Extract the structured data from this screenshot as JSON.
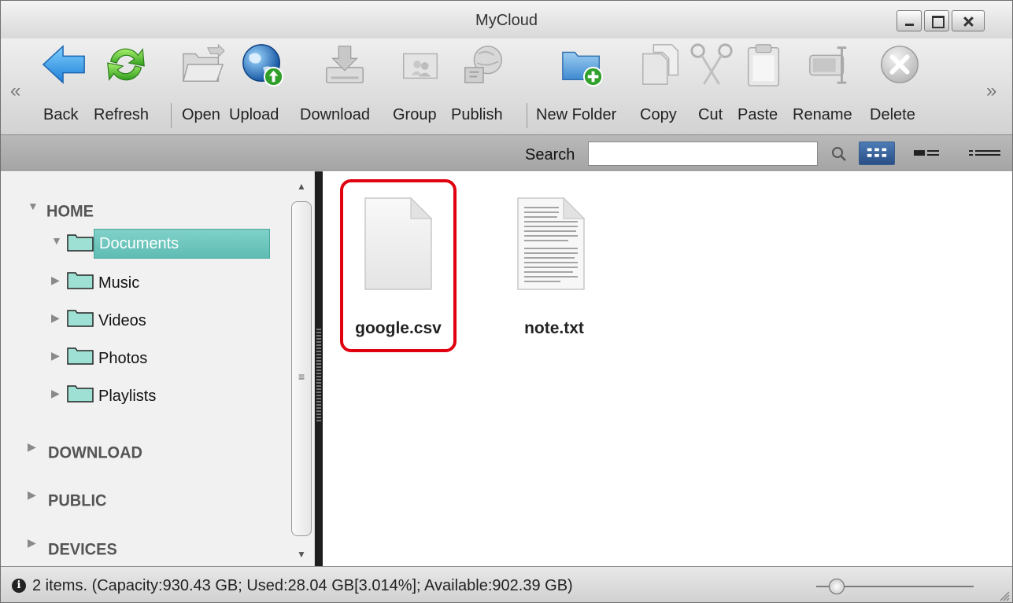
{
  "window": {
    "title": "MyCloud"
  },
  "toolbar": {
    "scroll_left": "«",
    "scroll_right": "»",
    "buttons": [
      {
        "id": "back",
        "label": "Back",
        "icon": "back-arrow-icon"
      },
      {
        "id": "refresh",
        "label": "Refresh",
        "icon": "refresh-icon"
      },
      {
        "id": "open",
        "label": "Open",
        "icon": "open-folder-icon"
      },
      {
        "id": "upload",
        "label": "Upload",
        "icon": "globe-upload-icon"
      },
      {
        "id": "download",
        "label": "Download",
        "icon": "download-icon"
      },
      {
        "id": "group",
        "label": "Group",
        "icon": "group-icon"
      },
      {
        "id": "publish",
        "label": "Publish",
        "icon": "publish-icon"
      },
      {
        "id": "new_folder",
        "label": "New Folder",
        "icon": "new-folder-icon"
      },
      {
        "id": "copy",
        "label": "Copy",
        "icon": "copy-icon"
      },
      {
        "id": "cut",
        "label": "Cut",
        "icon": "scissors-icon"
      },
      {
        "id": "paste",
        "label": "Paste",
        "icon": "clipboard-icon"
      },
      {
        "id": "rename",
        "label": "Rename",
        "icon": "rename-icon"
      },
      {
        "id": "delete",
        "label": "Delete",
        "icon": "delete-icon"
      }
    ]
  },
  "search": {
    "label": "Search",
    "value": "",
    "placeholder": ""
  },
  "sidebar": {
    "home": {
      "label": "HOME",
      "folders": [
        {
          "label": "Documents",
          "selected": true,
          "expanded": true
        },
        {
          "label": "Music"
        },
        {
          "label": "Videos"
        },
        {
          "label": "Photos"
        },
        {
          "label": "Playlists"
        }
      ]
    },
    "sections": [
      {
        "label": "DOWNLOAD"
      },
      {
        "label": "PUBLIC"
      },
      {
        "label": "DEVICES"
      }
    ]
  },
  "files": [
    {
      "name": "google.csv",
      "type": "blank-file-icon",
      "selected": true
    },
    {
      "name": "note.txt",
      "type": "text-file-icon",
      "selected": false
    }
  ],
  "status": {
    "text": "2 items. (Capacity:930.43 GB; Used:28.04 GB[3.014%]; Available:902.39 GB)",
    "zoom_level": 0.13
  },
  "colors": {
    "selection": "#68c4bb",
    "highlight_border": "#e0000f",
    "active_view": "#2f5f9e"
  }
}
